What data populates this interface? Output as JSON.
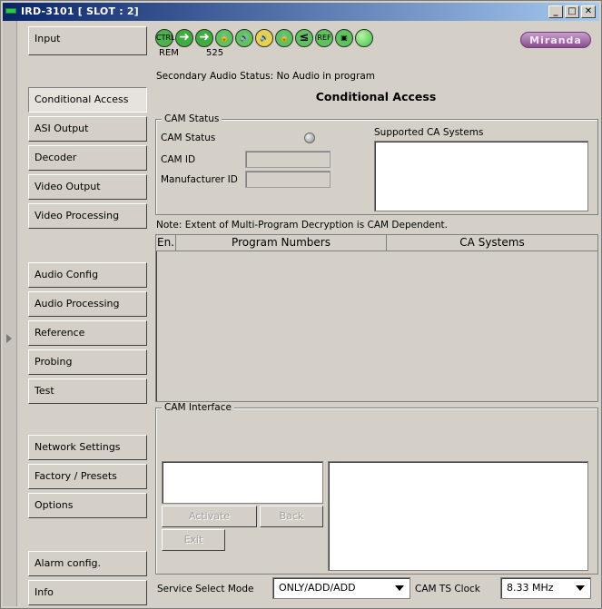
{
  "window": {
    "title": "IRD-3101 [ SLOT : 2]",
    "min_glyph": "_",
    "max_glyph": "□",
    "close_glyph": "✕"
  },
  "sidebar": {
    "items": [
      {
        "label": "Input",
        "icon": null
      },
      {
        "label": "Conditional Access",
        "active": true
      },
      {
        "label": "ASI Output"
      },
      {
        "label": "Decoder"
      },
      {
        "label": "Video Output"
      },
      {
        "label": "Video Processing"
      },
      {
        "label": "Audio Config"
      },
      {
        "label": "Audio Processing"
      },
      {
        "label": "Reference"
      },
      {
        "label": "Probing"
      },
      {
        "label": "Test"
      },
      {
        "label": "Network Settings"
      },
      {
        "label": "Factory / Presets"
      },
      {
        "label": "Options"
      },
      {
        "label": "Alarm config."
      },
      {
        "label": "Info"
      }
    ]
  },
  "toolbar": {
    "ctrl_label": "CTRL",
    "ref_label": "REF",
    "rem_label": "REM",
    "format_label": "525",
    "brand_logo": "Miranda",
    "icons": [
      "ctrl-icon",
      "arrow-right-icon",
      "arrow-right-icon",
      "lock-icon",
      "speaker-icon",
      "speaker-alert-icon",
      "lock-audio-icon",
      "less-than-icon",
      "ref-icon",
      "monitor-icon",
      "status-led-icon"
    ]
  },
  "status": {
    "secondary_audio": "Secondary Audio Status: No Audio in program"
  },
  "page": {
    "title": "Conditional Access"
  },
  "cam_status": {
    "group_title": "CAM Status",
    "cam_status_label": "CAM Status",
    "cam_id_label": "CAM ID",
    "cam_id_value": "",
    "manufacturer_id_label": "Manufacturer ID",
    "manufacturer_id_value": "",
    "supported_ca_label": "Supported CA Systems"
  },
  "note": "Note: Extent of Multi-Program Decryption is CAM Dependent.",
  "program_table": {
    "columns": [
      "En.",
      "Program Numbers",
      "CA Systems"
    ],
    "rows": []
  },
  "cam_interface": {
    "group_title": "CAM Interface",
    "activate_label": "Activate",
    "back_label": "Back",
    "exit_label": "Exit"
  },
  "bottom": {
    "service_select_label": "Service Select Mode",
    "service_select_value": "ONLY/ADD/ADD",
    "cam_ts_clock_label": "CAM TS Clock",
    "cam_ts_clock_value": "8.33 MHz"
  },
  "colors": {
    "accent": "#0a246a",
    "status_green": "#37c441",
    "brand": "#8a4c8f"
  }
}
